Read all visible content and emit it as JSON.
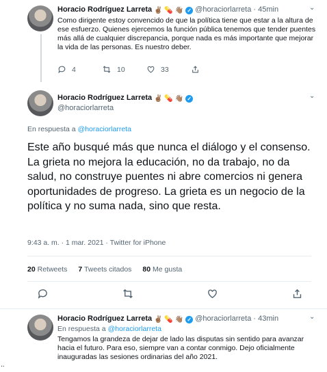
{
  "tweets": {
    "first": {
      "name": "Horacio Rodríguez Larreta",
      "handle": "@horaciorlarreta",
      "time": "45min",
      "emojis": "✌🏽 💊 👋🏽",
      "text": "Como dirigente estoy convencido de que la política tiene que estar a la altura de ese esfuerzo. Quienes ejercemos la función pública tenemos que tender puentes más allá de cualquier discrepancia, porque nada es más importante que mejorar la vida de las personas. Es nuestro deber.",
      "replies": "4",
      "retweets": "10",
      "likes": "33"
    },
    "main": {
      "name": "Horacio Rodríguez Larreta",
      "handle": "@horaciorlarreta",
      "emojis": "✌🏽 💊 👋🏽",
      "reply_prefix": "En respuesta a",
      "reply_to": "@horaciorlarreta",
      "text": "Este año busqué más que nunca el diálogo y el consenso. La grieta no mejora la educación, no da trabajo, no da salud, no construye puentes ni abre comercios ni genera oportunidades de progreso. La grieta es un negocio de la política y no suma nada, sino que resta.",
      "meta": "9:43 a. m. · 1 mar. 2021 · Twitter for iPhone",
      "retweets_count": "20",
      "retweets_label": "Retweets",
      "quotes_count": "7",
      "quotes_label": "Tweets citados",
      "likes_count": "80",
      "likes_label": "Me gusta"
    },
    "third": {
      "name": "Horacio Rodríguez Larreta",
      "handle": "@horaciorlarreta",
      "time": "43min",
      "emojis": "✌🏽 💊 👋🏽",
      "reply_prefix": "En respuesta a",
      "reply_to": "@horaciorlarreta",
      "text": "Tengamos la grandeza de dejar de lado las disputas sin sentido para avanzar hacia el futuro. Para eso, siempre van a contar conmigo. Dejo oficialmente inauguradas las sesiones ordinarias del año 2021."
    }
  },
  "misc": {
    "separator_dot": "·",
    "more_glyph": "⌄",
    "side_marker": ".."
  },
  "colors": {
    "accent": "#1d9bf0",
    "muted": "#536471",
    "text": "#0f1419"
  }
}
